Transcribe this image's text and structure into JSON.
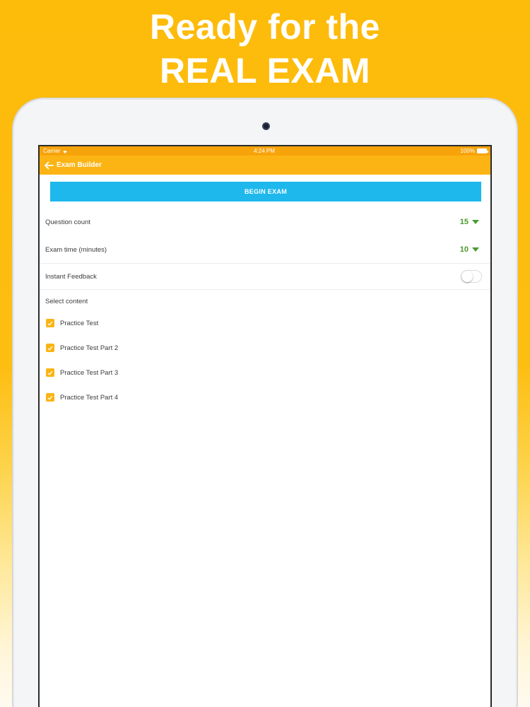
{
  "headline": {
    "line1": "Ready for the",
    "line2": "REAL EXAM"
  },
  "status_bar": {
    "carrier": "Carrier",
    "time": "4:24 PM",
    "battery": "100%"
  },
  "nav": {
    "title": "Exam Builder"
  },
  "begin_button": {
    "label": "BEGIN EXAM"
  },
  "settings": {
    "question_count": {
      "label": "Question count",
      "value": "15"
    },
    "exam_time": {
      "label": "Exam time (minutes)",
      "value": "10"
    },
    "instant_feedback": {
      "label": "Instant Feedback",
      "enabled": false
    }
  },
  "content": {
    "label": "Select content",
    "items": [
      {
        "label": "Practice Test",
        "checked": true
      },
      {
        "label": "Practice Test Part 2",
        "checked": true
      },
      {
        "label": "Practice Test Part 3",
        "checked": true
      },
      {
        "label": "Practice Test Part 4",
        "checked": true
      }
    ]
  },
  "colors": {
    "background": "#fdbb0a",
    "nav_bar": "#fbb414",
    "status_bar": "#f7a30a",
    "begin_button": "#1fb8ec",
    "stepper_value": "#4a9a2e",
    "checkbox": "#fbb414"
  }
}
